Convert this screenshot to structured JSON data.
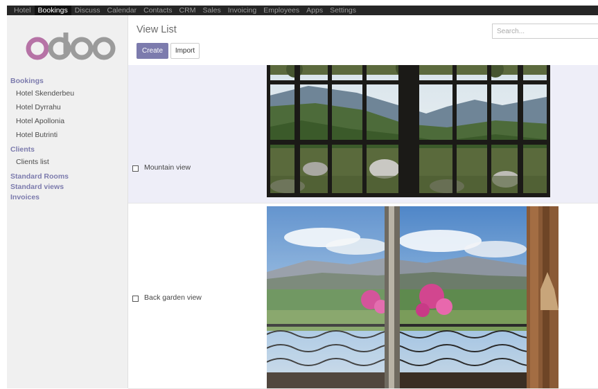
{
  "topbar": {
    "items": [
      {
        "label": "Hotel",
        "active": false
      },
      {
        "label": "Bookings",
        "active": true
      },
      {
        "label": "Discuss",
        "active": false
      },
      {
        "label": "Calendar",
        "active": false
      },
      {
        "label": "Contacts",
        "active": false
      },
      {
        "label": "CRM",
        "active": false
      },
      {
        "label": "Sales",
        "active": false
      },
      {
        "label": "Invoicing",
        "active": false
      },
      {
        "label": "Employees",
        "active": false
      },
      {
        "label": "Apps",
        "active": false
      },
      {
        "label": "Settings",
        "active": false
      }
    ]
  },
  "sidebar": {
    "logo_text": "odoo",
    "sections": {
      "bookings": "Bookings",
      "bookings_items": [
        "Hotel Skenderbeu",
        "Hotel Dyrrahu",
        "Hotel Apollonia",
        "Hotel Butrinti"
      ],
      "clients": "Clients",
      "clients_items": [
        "Clients list"
      ],
      "standard_rooms": "Standard Rooms",
      "standard_views": "Standard views",
      "invoices": "Invoices"
    }
  },
  "control_panel": {
    "title": "View List",
    "create_label": "Create",
    "import_label": "Import",
    "search_placeholder": "Search..."
  },
  "list": {
    "rows": [
      {
        "label": "Mountain view",
        "image": "mountain-view-photo"
      },
      {
        "label": "Back garden view",
        "image": "garden-balcony-photo"
      }
    ]
  },
  "colors": {
    "accent": "#7c7bad",
    "topbar": "#262626",
    "sidebar": "#f0f0f0",
    "row_highlight": "#eeeef8"
  }
}
